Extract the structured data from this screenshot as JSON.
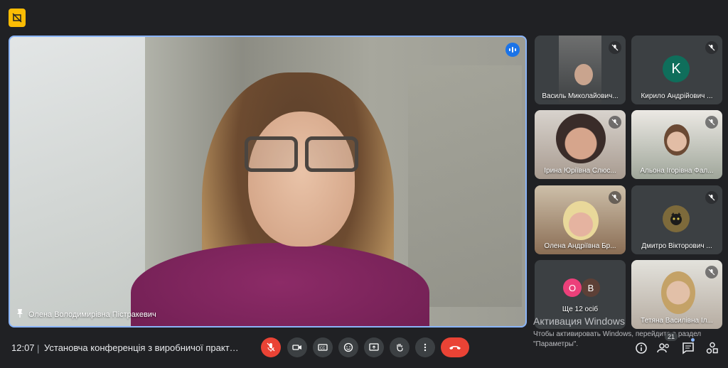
{
  "main": {
    "pinned_name": "Олена Володимирівна Пістракевич"
  },
  "participants": [
    {
      "name": "Василь Миколайович..."
    },
    {
      "name": "Кирило Андрійович ...",
      "initial": "K"
    },
    {
      "name": "Ірина Юріївна Слюс..."
    },
    {
      "name": "Альона Ігорівна Фал..."
    },
    {
      "name": "Олена Андріївна Бр..."
    },
    {
      "name": "Дмитро Вікторович ..."
    },
    {
      "name": "Ще 12 осіб",
      "avatars": [
        "O",
        "B"
      ]
    },
    {
      "name": "Тетяна Василівна Іл..."
    }
  ],
  "watermark": {
    "title": "Активация Windows",
    "line1": "Чтобы активировать Windows, перейдите в раздел",
    "line2": "\"Параметры\"."
  },
  "bottom_bar": {
    "time": "12:07",
    "separator": "|",
    "meeting_title": "Установча конференція з виробничої практики (к...",
    "people_count": "21"
  },
  "colors": {
    "accent": "#8ab4f8",
    "danger": "#ea4335",
    "warning": "#fbbc04",
    "surface": "#3c4043",
    "background": "#202124"
  }
}
